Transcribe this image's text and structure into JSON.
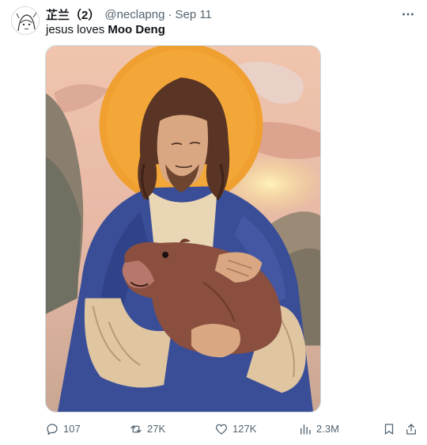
{
  "author": {
    "display_name": "芷兰（2）",
    "handle": "@neclapng",
    "date": "Sep 11",
    "avatar_icon": "avatar-anime-sketch"
  },
  "tweet": {
    "text_plain": "jesus loves ",
    "text_bold": "Moo Deng"
  },
  "media": {
    "colors": {
      "halo": "#f0a030",
      "robe": "#3a4e98",
      "sky_top": "#f3c9b0",
      "sky_mid": "#e4b7a6",
      "hippo": "#8a4f3f"
    }
  },
  "actions": {
    "replies": "107",
    "reposts": "27K",
    "likes": "127K",
    "views": "2.3M"
  },
  "icons": {
    "more": "more-dots-icon",
    "reply": "reply-icon",
    "repost": "repost-icon",
    "like": "heart-icon",
    "views": "views-icon",
    "bookmark": "bookmark-icon",
    "share": "share-icon"
  }
}
